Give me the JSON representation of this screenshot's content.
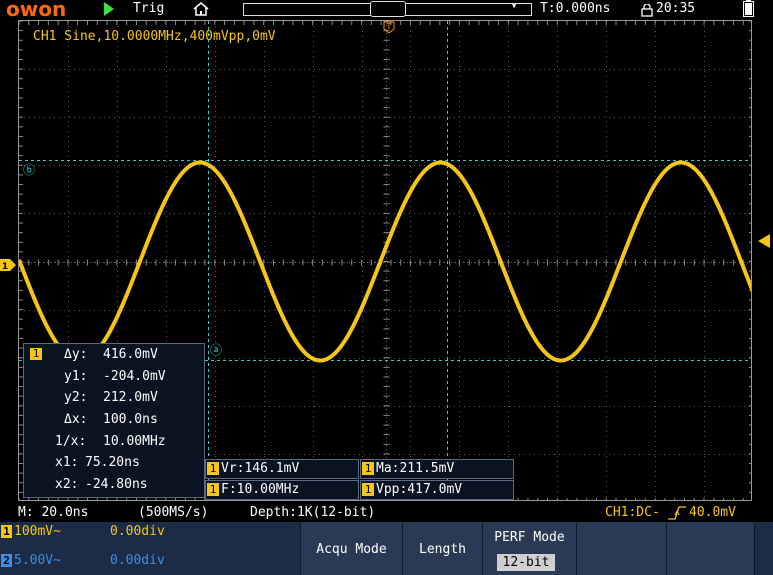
{
  "topbar": {
    "logo": "OWON",
    "trigger_status": "Trig",
    "time_offset": "T:0.000ns",
    "clock": "20:35"
  },
  "screen": {
    "channel_info": "CH1 Sine,10.0000MHz,400mVpp,0mV",
    "cursor_a_label": "ⓐ",
    "cursor_b_label": "ⓑ",
    "trigger_marker": "T",
    "ch1_marker": "1"
  },
  "measurements": {
    "badge": "1",
    "rows": [
      {
        "label": "Δy:",
        "value": "416.0mV"
      },
      {
        "label": "y1:",
        "value": "-204.0mV"
      },
      {
        "label": "y2:",
        "value": "212.0mV"
      },
      {
        "label": "Δx:",
        "value": "100.0ns"
      },
      {
        "label": "1/x:",
        "value": "10.00MHz"
      },
      {
        "label": "x1:",
        "value": "75.20ns"
      },
      {
        "label": "x2:",
        "value": "-24.80ns"
      }
    ]
  },
  "stats": {
    "badge": "1",
    "vr": "Vr:146.1mV",
    "ma": "Ma:211.5mV",
    "freq": "F:10.00MHz",
    "vpp": "Vpp:417.0mV"
  },
  "status": {
    "timebase": "M: 20.0ns",
    "sample_rate": "(500MS/s)",
    "depth": "Depth:1K(12-bit)",
    "trigger": "CH1:DC-",
    "trigger_level": "40.0mV"
  },
  "bottom": {
    "ch1": {
      "badge": "1",
      "scale": "100mV~",
      "offset": "0.00div"
    },
    "ch2": {
      "badge": "2",
      "scale": "5.00V~",
      "offset": "0.00div"
    },
    "acqu_mode": "Acqu Mode",
    "length": "Length",
    "perf_mode": "PERF Mode",
    "perf_value": "12-bit"
  },
  "colors": {
    "ch1": "#f5c518",
    "ch2": "#3a8ee6",
    "cursor": "#2fd0d0",
    "logo": "#ff6a00"
  },
  "chart_data": {
    "type": "line",
    "series": [
      {
        "name": "CH1",
        "frequency_mhz": 10.0,
        "vpp_mv": 400,
        "offset_mv": 0
      }
    ],
    "xlabel": "",
    "ylabel": ""
  }
}
